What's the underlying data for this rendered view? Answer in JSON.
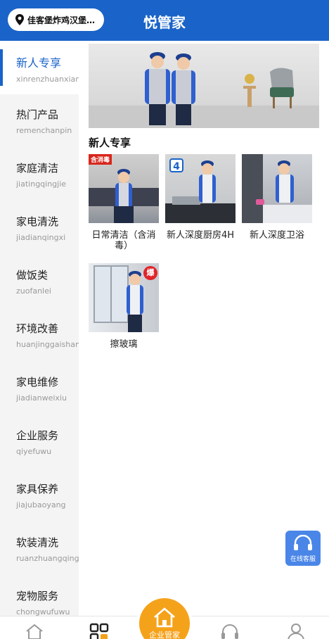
{
  "header": {
    "location": "佳客堡炸鸡汉堡…",
    "title": "悦管家"
  },
  "sidebar": {
    "items": [
      {
        "label": "新人专享",
        "pinyin": "xinrenzhuanxian",
        "active": true
      },
      {
        "label": "热门产品",
        "pinyin": "remenchanpin"
      },
      {
        "label": "家庭清洁",
        "pinyin": "jiatingqingjie"
      },
      {
        "label": "家电清洗",
        "pinyin": "jiadianqingxi"
      },
      {
        "label": "做饭类",
        "pinyin": "zuofanlei"
      },
      {
        "label": "环境改善",
        "pinyin": "huanjinggaishan"
      },
      {
        "label": "家电维修",
        "pinyin": "jiadianweixiu"
      },
      {
        "label": "企业服务",
        "pinyin": "qiyefuwu"
      },
      {
        "label": "家具保养",
        "pinyin": "jiajubaoyang"
      },
      {
        "label": "软装清洗",
        "pinyin": "ruanzhuangqing"
      },
      {
        "label": "宠物服务",
        "pinyin": "chongwufuwu"
      }
    ]
  },
  "main": {
    "section_title": "新人专享",
    "products": [
      {
        "name": "日常清洁（含消毒）",
        "tag": "含消毒"
      },
      {
        "name": "新人深度厨房4H",
        "tag": "4"
      },
      {
        "name": "新人深度卫浴",
        "tag": ""
      },
      {
        "name": "擦玻璃",
        "tag": "爆"
      }
    ]
  },
  "float_button": {
    "label": "在线客服",
    "icon": "headset-icon"
  },
  "tabbar": {
    "center_label": "企业管家",
    "tabs": [
      {
        "icon": "home-icon"
      },
      {
        "icon": "category-icon"
      },
      {
        "icon": "service-icon"
      },
      {
        "icon": "profile-icon"
      }
    ]
  },
  "colors": {
    "brand": "#1a63c8",
    "accent": "#f5a21b",
    "tag_red": "#d8261c"
  }
}
